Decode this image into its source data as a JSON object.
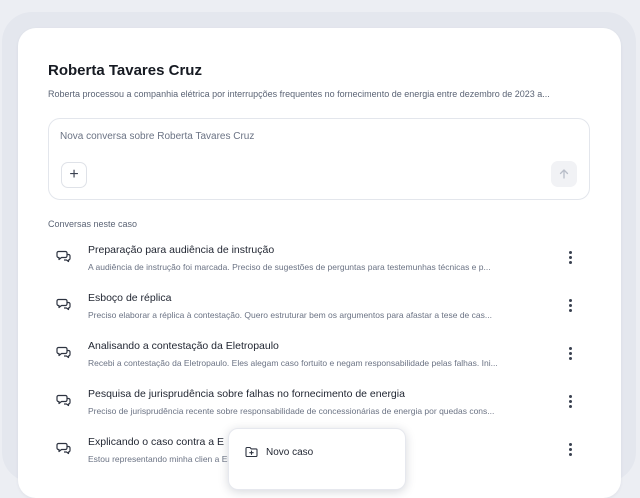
{
  "case": {
    "title": "Roberta Tavares Cruz",
    "description": "Roberta processou a companhia elétrica por interrupções frequentes no fornecimento de energia entre dezembro de 2023 a..."
  },
  "composer": {
    "placeholder": "Nova conversa sobre Roberta Tavares Cruz",
    "add_label": "+"
  },
  "conversations": {
    "section_label": "Conversas neste caso",
    "items": [
      {
        "title": "Preparação para audiência de instrução",
        "snippet": "A audiência de instrução foi marcada. Preciso de sugestões de perguntas para testemunhas técnicas e p..."
      },
      {
        "title": "Esboço de réplica",
        "snippet": "Preciso elaborar a réplica à contestação. Quero estruturar bem os argumentos para afastar a tese de cas..."
      },
      {
        "title": "Analisando a contestação da Eletropaulo",
        "snippet": "Recebi a contestação da Eletropaulo. Eles alegam caso fortuito e negam responsabilidade pelas falhas. Ini..."
      },
      {
        "title": "Pesquisa de jurisprudência sobre falhas no fornecimento de energia",
        "snippet": "Preciso de jurisprudência recente sobre responsabilidade de concessionárias de energia por quedas cons..."
      },
      {
        "title": "Explicando o caso contra a E",
        "snippet": "Estou representando minha clien                                           a Eletropaulo. O caso envo..."
      }
    ]
  },
  "menu": {
    "new_case_label": "Novo caso"
  },
  "colors": {
    "background": "#eceef3",
    "card": "#ffffff",
    "text_primary": "#1f2430",
    "text_secondary": "#6b7384"
  }
}
